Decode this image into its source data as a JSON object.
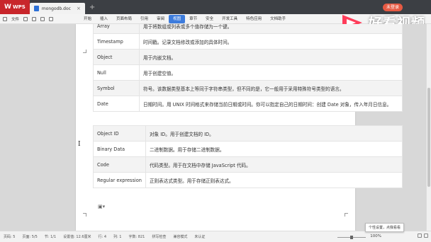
{
  "titlebar": {
    "app_name": "WPS",
    "doc_tab": "mongodb.doc",
    "new_tab": "+",
    "login_button": "未登录",
    "watermark": "好看视频"
  },
  "menubar": {
    "file": "文件",
    "items": [
      "开始",
      "插入",
      "页面布局",
      "引用",
      "审阅",
      "视图",
      "章节",
      "安全",
      "开发工具",
      "特色应用",
      "文档助手"
    ],
    "active_index": 5
  },
  "table1": [
    {
      "key": "Array",
      "desc": "用于将数组或列表或多个值存储为一个键。"
    },
    {
      "key": "Timestamp",
      "desc": "时间戳。记录文档修改或添加的具体时间。"
    },
    {
      "key": "Object",
      "desc": "用于内嵌文档。"
    },
    {
      "key": "Null",
      "desc": "用于创建空值。"
    },
    {
      "key": "Symbol",
      "desc": "符号。该数据类型基本上等同于字符串类型，但不同的是，它一般用于采用特殊符号类型的语言。"
    },
    {
      "key": "Date",
      "desc": "日期时间。用 UNIX 时间格式来存储当前日期或时间。你可以指定自己的日期时间：创建 Date 对象，传入年月日信息。"
    }
  ],
  "table2": [
    {
      "key": "Object ID",
      "desc": "对象 ID。用于创建文档的 ID。"
    },
    {
      "key": "Binary Data",
      "desc": "二进制数据。用于存储二进制数据。"
    },
    {
      "key": "Code",
      "desc": "代码类型。用于在文档中存储 JavaScript 代码。"
    },
    {
      "key": "Regular expression",
      "desc": "正则表达式类型。用于存储正则表达式。"
    }
  ],
  "statusbar": {
    "items": [
      "页码: 5",
      "页面: 5/5",
      "节: 1/1",
      "设置值: 12.6厘米",
      "行: 4",
      "列: 1",
      "字数: 821",
      "拼写检查",
      "兼容模式",
      "未认证"
    ],
    "zoom": "100%",
    "tooltip": "个性设置，点我看看"
  }
}
